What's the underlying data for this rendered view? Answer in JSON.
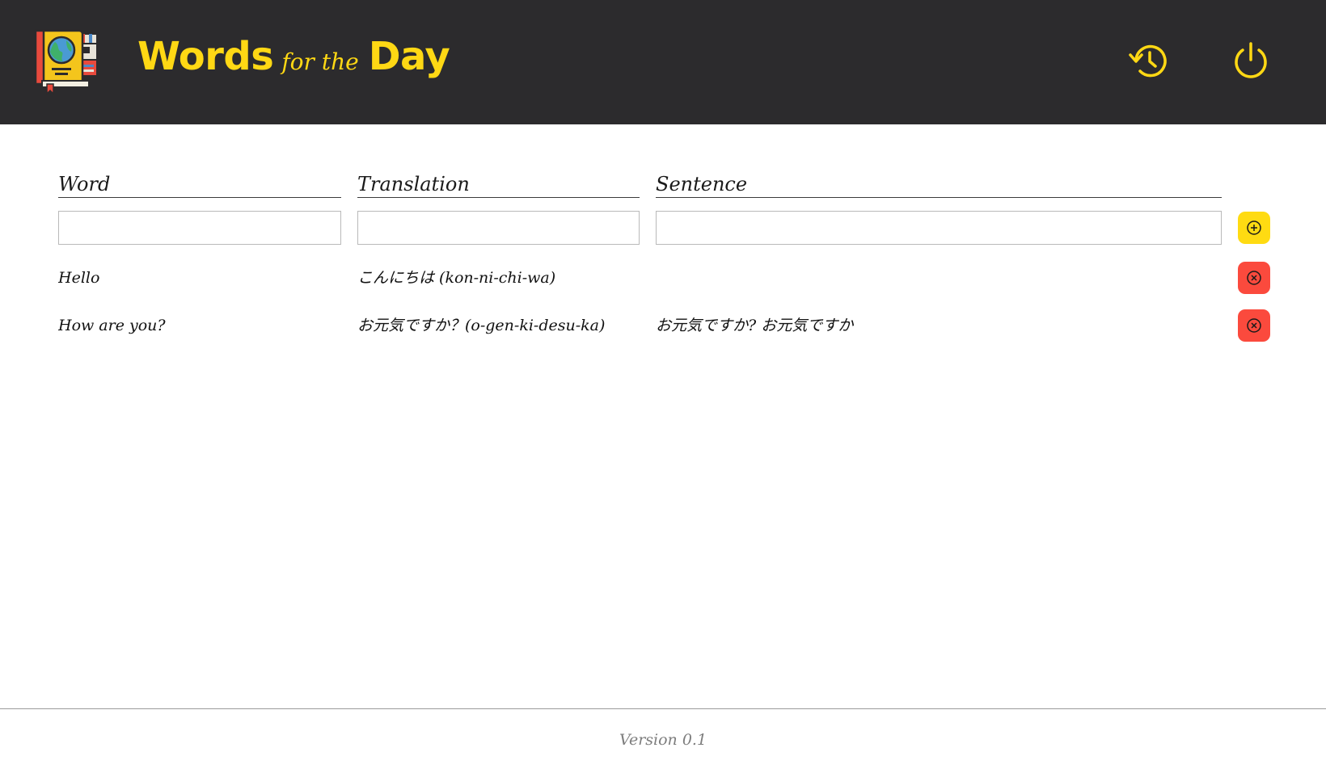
{
  "header": {
    "title_part1": "Words",
    "title_part2": "for the",
    "title_part3": "Day",
    "accent_color": "#ffd814",
    "background_color": "#2c2b2d",
    "history_icon": "history-icon",
    "power_icon": "power-icon",
    "logo_icon": "book-globe-logo"
  },
  "columns": {
    "word": "Word",
    "translation": "Translation",
    "sentence": "Sentence"
  },
  "inputs": {
    "word_value": "",
    "translation_value": "",
    "sentence_value": ""
  },
  "add_button": {
    "icon": "plus-circle-icon",
    "color": "#ffdb12"
  },
  "delete_button": {
    "icon": "x-circle-icon",
    "color": "#fb4a3d"
  },
  "entries": [
    {
      "word": "Hello",
      "translation": "こんにちは (kon-ni-chi-wa)",
      "sentence": ""
    },
    {
      "word": "How are you?",
      "translation": "お元気ですか？(o-gen-ki-desu-ka)",
      "sentence": "お元気ですか? お元気ですか"
    }
  ],
  "footer": {
    "version": "Version 0.1"
  }
}
